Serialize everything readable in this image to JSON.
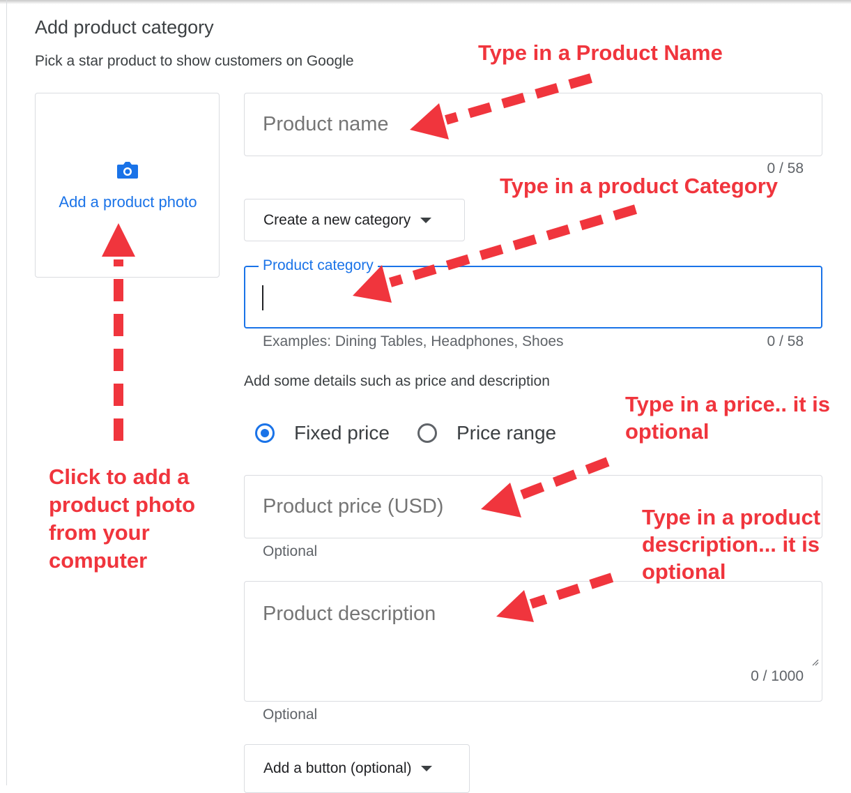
{
  "form": {
    "title": "Add product category",
    "subtitle": "Pick a star product to show customers on Google",
    "photo": {
      "label": "Add a product photo",
      "icon": "camera-icon"
    },
    "product_name": {
      "placeholder": "Product name",
      "value": "",
      "counter": "0 / 58"
    },
    "category_dropdown": {
      "label": "Create a new category"
    },
    "product_category": {
      "label": "Product category",
      "value": "",
      "hint": "Examples: Dining Tables, Headphones, Shoes",
      "counter": "0 / 58"
    },
    "details_text": "Add some details such as price and description",
    "price_type": {
      "options": [
        "Fixed price",
        "Price range"
      ],
      "selected": "Fixed price"
    },
    "product_price": {
      "placeholder": "Product price (USD)",
      "value": "",
      "helper": "Optional"
    },
    "product_description": {
      "placeholder": "Product description",
      "value": "",
      "counter": "0 / 1000",
      "helper": "Optional"
    },
    "add_button": {
      "label": "Add a button (optional)"
    }
  },
  "annotations": {
    "name": "Type in a Product Name",
    "category": "Type in a product Category",
    "price": "Type in a price.. it is optional",
    "description": "Type in a product description... it is optional",
    "photo": "Click to add a product photo from your computer",
    "color": "#f0353d"
  },
  "colors": {
    "accent": "#1a73e8",
    "annotation": "#f0353d",
    "border": "#dadce0"
  }
}
